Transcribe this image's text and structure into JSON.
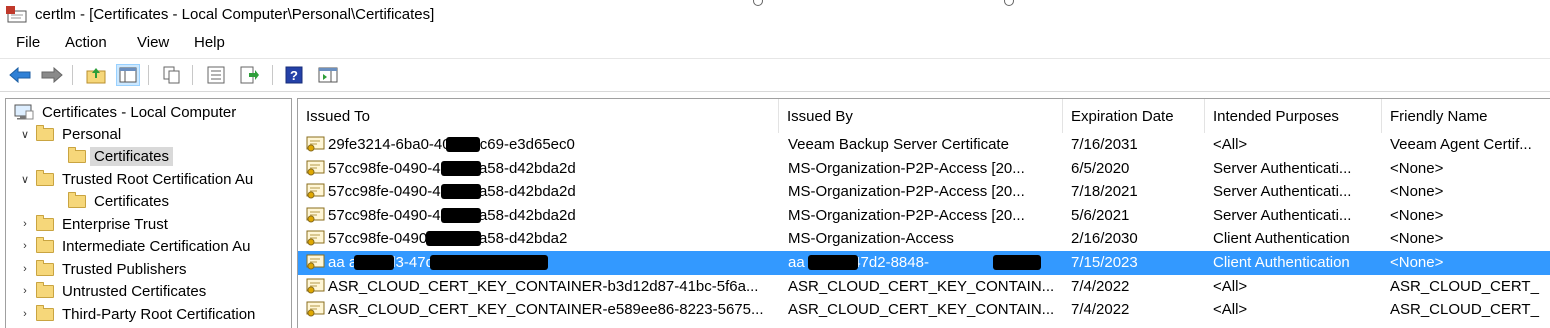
{
  "window": {
    "title": "certlm - [Certificates - Local Computer\\Personal\\Certificates]",
    "app_icon": "certificate-manager-icon"
  },
  "menu": [
    "File",
    "Action",
    "View",
    "Help"
  ],
  "toolbar": {
    "icons": [
      "back-icon",
      "forward-icon",
      "up-folder-icon",
      "show-hide-tree-icon",
      "copy-icon",
      "properties-icon",
      "export-list-icon",
      "help-icon",
      "show-hide-action-pane-icon"
    ]
  },
  "tree": [
    {
      "label": "Certificates - Local Computer",
      "level": 0,
      "chevron": "",
      "icon": "computer-icon"
    },
    {
      "label": "Personal",
      "level": 1,
      "chevron": "expanded",
      "icon": "folder-icon"
    },
    {
      "label": "Certificates",
      "level": 2,
      "chevron": "",
      "icon": "folder-icon",
      "selected": true
    },
    {
      "label": "Trusted Root Certification Au",
      "level": 1,
      "chevron": "expanded",
      "icon": "folder-icon"
    },
    {
      "label": "Certificates",
      "level": 2,
      "chevron": "",
      "icon": "folder-icon"
    },
    {
      "label": "Enterprise Trust",
      "level": 1,
      "chevron": "collapsed",
      "icon": "folder-icon"
    },
    {
      "label": "Intermediate Certification Au",
      "level": 1,
      "chevron": "collapsed",
      "icon": "folder-icon"
    },
    {
      "label": "Trusted Publishers",
      "level": 1,
      "chevron": "collapsed",
      "icon": "folder-icon"
    },
    {
      "label": "Untrusted Certificates",
      "level": 1,
      "chevron": "collapsed",
      "icon": "folder-icon"
    },
    {
      "label": "Third-Party Root Certification",
      "level": 1,
      "chevron": "collapsed",
      "icon": "folder-icon"
    }
  ],
  "columns": [
    "Issued To",
    "Issued By",
    "Expiration Date",
    "Intended Purposes",
    "Friendly Name"
  ],
  "rows": [
    {
      "issued_to": "29fe3214-6ba0-40c6-9c69-e3d65ec0",
      "issued_by": "Veeam Backup Server Certificate",
      "expiration": "7/16/2031",
      "purposes": "<All>",
      "friendly": "Veeam Agent Certif..."
    },
    {
      "issued_to": "57cc98fe-0490-4574-8a58-d42bda2d",
      "issued_by": "MS-Organization-P2P-Access [20...",
      "expiration": "6/5/2020",
      "purposes": "Server Authenticati...",
      "friendly": "<None>"
    },
    {
      "issued_to": "57cc98fe-0490-4574-8a58-d42bda2d",
      "issued_by": "MS-Organization-P2P-Access [20...",
      "expiration": "7/18/2021",
      "purposes": "Server Authenticati...",
      "friendly": "<None>"
    },
    {
      "issued_to": "57cc98fe-0490-4574-8a58-d42bda2d",
      "issued_by": "MS-Organization-P2P-Access [20...",
      "expiration": "5/6/2021",
      "purposes": "Server Authenticati...",
      "friendly": "<None>"
    },
    {
      "issued_to": "57cc98fe-0490-4574-8a58-d42bda2",
      "issued_by": "MS-Organization-Access",
      "expiration": "2/16/2030",
      "purposes": "Client Authentication",
      "friendly": "<None>"
    },
    {
      "issued_to": "aa          a9-d6d3-47d2-8848-ddb",
      "issued_by": "aa          -d6d3-47d2-8848-",
      "expiration": "7/15/2023",
      "purposes": "Client Authentication",
      "friendly": "<None>",
      "selected": true
    },
    {
      "issued_to": "ASR_CLOUD_CERT_KEY_CONTAINER-b3d12d87-41bc-5f6a...",
      "issued_by": "ASR_CLOUD_CERT_KEY_CONTAIN...",
      "expiration": "7/4/2022",
      "purposes": "<All>",
      "friendly": "ASR_CLOUD_CERT_..."
    },
    {
      "issued_to": "ASR_CLOUD_CERT_KEY_CONTAINER-e589ee86-8223-5675...",
      "issued_by": "ASR_CLOUD_CERT_KEY_CONTAIN...",
      "expiration": "7/4/2022",
      "purposes": "<All>",
      "friendly": "ASR_CLOUD_CERT_..."
    }
  ],
  "colors": {
    "selection": "#3399ff",
    "tree_selection": "#d9d9d9",
    "folder": "#f6d77a"
  }
}
